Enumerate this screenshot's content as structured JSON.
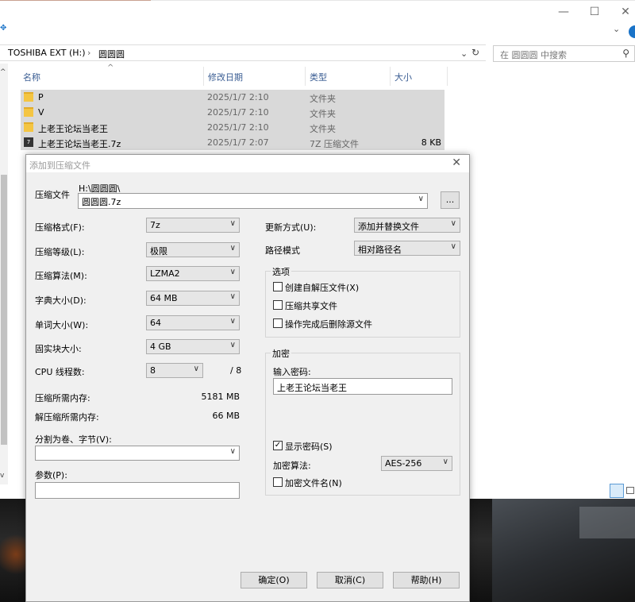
{
  "explorer": {
    "window_controls": {
      "minimize": "—",
      "maximize": "☐",
      "close": "✕"
    },
    "address": {
      "drive": "TOSHIBA EXT (H:)",
      "separator": "›",
      "folder": "圆圆圆"
    },
    "search_placeholder": "在 圆圆圆 中搜索",
    "columns": {
      "name": "名称",
      "modified": "修改日期",
      "type": "类型",
      "size": "大小"
    },
    "files": [
      {
        "name": "P",
        "modified": "2025/1/7 2:10",
        "type": "文件夹",
        "size": "",
        "icon": "folder-icon"
      },
      {
        "name": "V",
        "modified": "2025/1/7 2:10",
        "type": "文件夹",
        "size": "",
        "icon": "folder-icon"
      },
      {
        "name": "上老王论坛当老王",
        "modified": "2025/1/7 2:10",
        "type": "文件夹",
        "size": "",
        "icon": "folder-icon"
      },
      {
        "name": "上老王论坛当老王.7z",
        "modified": "2025/1/7 2:07",
        "type": "7Z 压缩文件",
        "size": "8 KB",
        "icon": "7z-archive-icon"
      }
    ]
  },
  "dialog": {
    "title": "添加到压缩文件",
    "archive_label": "压缩文件",
    "archive_dir": "H:\\圆圆圆\\",
    "archive_name": "圆圆圆.7z",
    "browse_label": "...",
    "format_label": "压缩格式(F):",
    "format_value": "7z",
    "level_label": "压缩等级(L):",
    "level_value": "极限",
    "method_label": "压缩算法(M):",
    "method_value": "LZMA2",
    "dict_label": "字典大小(D):",
    "dict_value": "64 MB",
    "word_label": "单词大小(W):",
    "word_value": "64",
    "solid_label": "固实块大小:",
    "solid_value": "4 GB",
    "threads_label": "CPU 线程数:",
    "threads_value": "8",
    "threads_total": "/ 8",
    "mem_compress_label": "压缩所需内存:",
    "mem_compress_value": "5181 MB",
    "mem_decompress_label": "解压缩所需内存:",
    "mem_decompress_value": "66 MB",
    "split_label": "分割为卷、字节(V):",
    "split_value": "",
    "params_label": "参数(P):",
    "params_value": "",
    "update_label": "更新方式(U):",
    "update_value": "添加并替换文件",
    "pathmode_label": "路径模式",
    "pathmode_value": "相对路径名",
    "options_title": "选项",
    "opt_sfx": "创建自解压文件(X)",
    "opt_shared": "压缩共享文件",
    "opt_delete": "操作完成后删除源文件",
    "encrypt_title": "加密",
    "password_label": "输入密码:",
    "password_value": "上老王论坛当老王",
    "show_password": "显示密码(S)",
    "show_password_checked": true,
    "enc_method_label": "加密算法:",
    "enc_method_value": "AES-256",
    "encrypt_names": "加密文件名(N)",
    "ok_label": "确定(O)",
    "cancel_label": "取消(C)",
    "help_label": "帮助(H)"
  }
}
